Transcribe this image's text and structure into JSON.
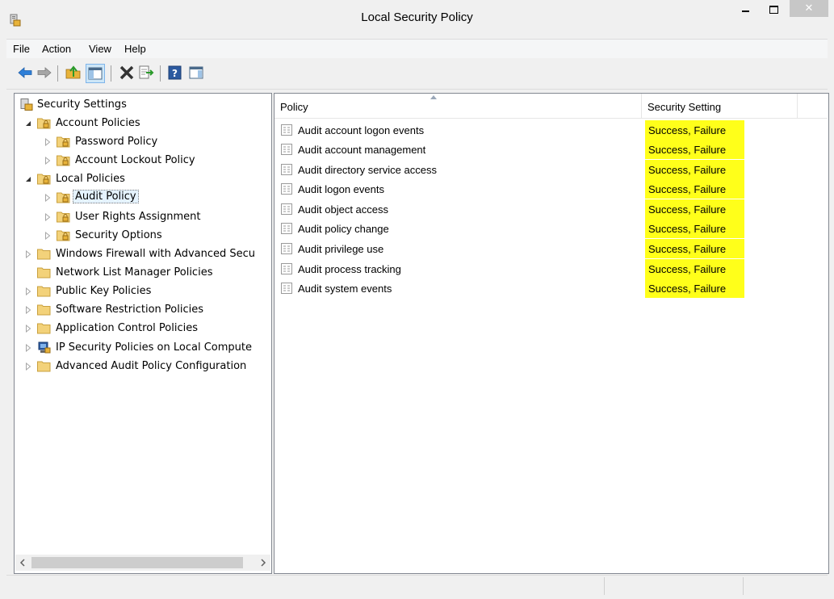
{
  "window": {
    "title": "Local Security Policy",
    "close_glyph": "✕"
  },
  "menu": [
    "File",
    "Action",
    "View",
    "Help"
  ],
  "toolbar": {
    "icons": [
      "back-arrow-icon",
      "forward-arrow-icon",
      "up-folder-icon",
      "show-hide-tree-icon",
      "delete-icon",
      "export-list-icon",
      "help-icon",
      "properties-icon"
    ]
  },
  "tree": {
    "root": "Security Settings",
    "items": [
      {
        "label": "Account Policies",
        "level": 1
      },
      {
        "label": "Password Policy",
        "level": 2
      },
      {
        "label": "Account Lockout Policy",
        "level": 2
      },
      {
        "label": "Local Policies",
        "level": 1
      },
      {
        "label": "Audit Policy",
        "level": 2,
        "selected": true
      },
      {
        "label": "User Rights Assignment",
        "level": 2
      },
      {
        "label": "Security Options",
        "level": 2
      },
      {
        "label": "Windows Firewall with Advanced Secu",
        "level": 1
      },
      {
        "label": "Network List Manager Policies",
        "level": 1
      },
      {
        "label": "Public Key Policies",
        "level": 1
      },
      {
        "label": "Software Restriction Policies",
        "level": 1
      },
      {
        "label": "Application Control Policies",
        "level": 1
      },
      {
        "label": "IP Security Policies on Local Compute",
        "level": 1
      },
      {
        "label": "Advanced Audit Policy Configuration",
        "level": 1
      }
    ]
  },
  "table": {
    "columns": [
      "Policy",
      "Security Setting"
    ],
    "rows": [
      {
        "policy": "Audit account logon events",
        "setting": "Success, Failure"
      },
      {
        "policy": "Audit account management",
        "setting": "Success, Failure"
      },
      {
        "policy": "Audit directory service access",
        "setting": "Success, Failure"
      },
      {
        "policy": "Audit logon events",
        "setting": "Success, Failure"
      },
      {
        "policy": "Audit object access",
        "setting": "Success, Failure"
      },
      {
        "policy": "Audit policy change",
        "setting": "Success, Failure"
      },
      {
        "policy": "Audit privilege use",
        "setting": "Success, Failure"
      },
      {
        "policy": "Audit process tracking",
        "setting": "Success, Failure"
      },
      {
        "policy": "Audit system events",
        "setting": "Success, Failure"
      }
    ]
  },
  "colors": {
    "highlight": "#ffff1a",
    "selection": "#e5f3ff",
    "folder": "#f3d27a"
  }
}
